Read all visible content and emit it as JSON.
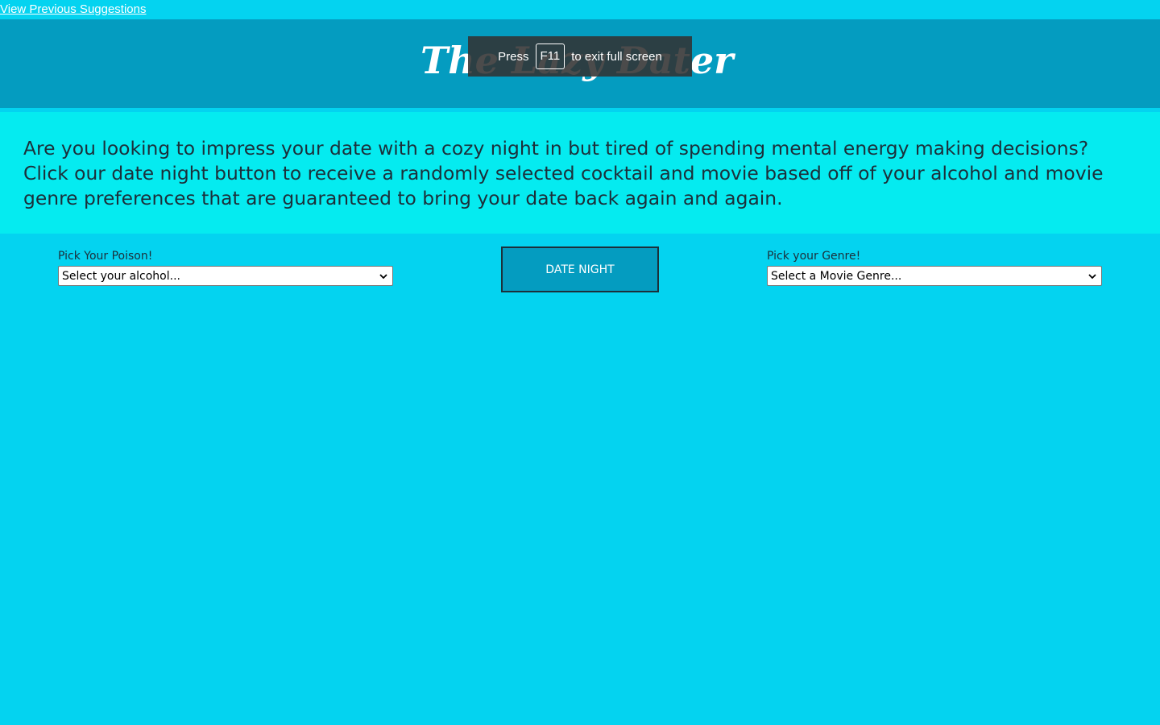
{
  "nav": {
    "previous_link": "View Previous Suggestions"
  },
  "header": {
    "logo_text": "The Lazy Dater"
  },
  "fullscreen_banner": {
    "press": "Press",
    "key": "F11",
    "message": "to exit full screen"
  },
  "intro": {
    "text": "Are you looking to impress your date with a cozy night in but tired of spending mental energy making decisions? Click our date night button to receive a randomly selected cocktail and movie based off of your alcohol and movie genre preferences that are guaranteed to bring your date back again and again."
  },
  "alcohol": {
    "label": "Pick Your Poison!",
    "selected": "Select your alcohol..."
  },
  "genre": {
    "label": "Pick your Genre!",
    "selected": "Select a Movie Genre..."
  },
  "action": {
    "button_label": "DATE NIGHT"
  },
  "colors": {
    "page_bg": "#04d3f0",
    "header_bg": "#049cc0",
    "intro_bg": "#05ebf0",
    "button_bg": "#049cc0"
  }
}
